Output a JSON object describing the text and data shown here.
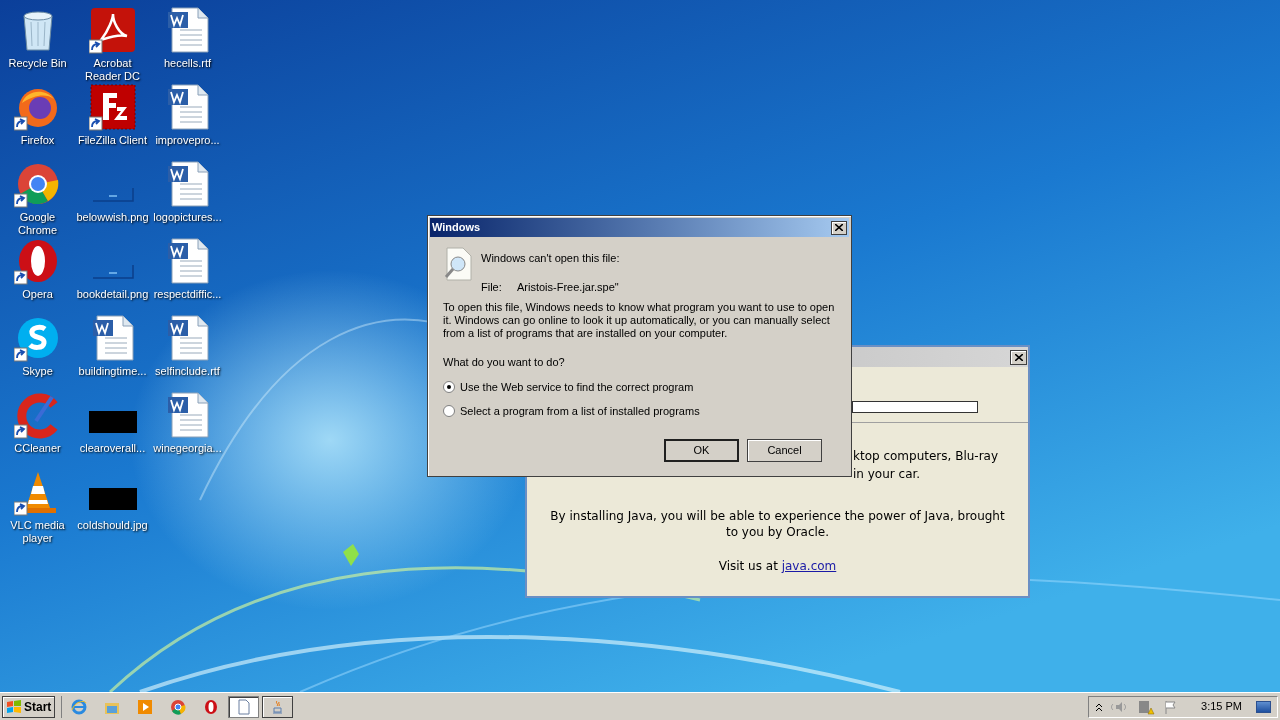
{
  "desktop_icons": [
    {
      "label": "Recycle Bin",
      "kind": "recycle",
      "shortcut": false
    },
    {
      "label": "Firefox",
      "kind": "firefox",
      "shortcut": true
    },
    {
      "label": "Google Chrome",
      "kind": "chrome",
      "shortcut": true
    },
    {
      "label": "Opera",
      "kind": "opera",
      "shortcut": true
    },
    {
      "label": "Skype",
      "kind": "skype",
      "shortcut": true
    },
    {
      "label": "CCleaner",
      "kind": "ccleaner",
      "shortcut": true
    },
    {
      "label": "VLC media player",
      "kind": "vlc",
      "shortcut": true
    },
    {
      "label": "Acrobat Reader DC",
      "kind": "pdf",
      "shortcut": true
    },
    {
      "label": "FileZilla Client",
      "kind": "filezilla",
      "shortcut": true
    },
    {
      "label": "belowwish.png",
      "kind": "blank-image",
      "shortcut": false
    },
    {
      "label": "bookdetail.png",
      "kind": "blank-image",
      "shortcut": false
    },
    {
      "label": "buildingtime...",
      "kind": "doc",
      "shortcut": false
    },
    {
      "label": "clearoverall...",
      "kind": "black-image",
      "shortcut": false
    },
    {
      "label": "coldshould.jpg",
      "kind": "black-image",
      "shortcut": false
    },
    {
      "label": "hecells.rtf",
      "kind": "doc",
      "shortcut": false
    },
    {
      "label": "improvepro...",
      "kind": "doc",
      "shortcut": false
    },
    {
      "label": "logopictures...",
      "kind": "doc",
      "shortcut": false
    },
    {
      "label": "respectdiffic...",
      "kind": "doc",
      "shortcut": false
    },
    {
      "label": "selfinclude.rtf",
      "kind": "doc",
      "shortcut": false
    },
    {
      "label": "winegeorgia...",
      "kind": "doc",
      "shortcut": false
    }
  ],
  "java_window": {
    "fragment_1": "ktop computers, Blu-ray",
    "fragment_2": "in your car.",
    "paragraph": "By installing Java, you will be able to experience the power of Java, brought to you by Oracle.",
    "visit_text": "Visit us at",
    "link": "java.com"
  },
  "dialog": {
    "title": "Windows",
    "heading": "Windows can't open this file:",
    "file_label": "File:",
    "file_name": "Aristois-Free.jar.spe\"",
    "body": "To open this file, Windows needs to know what program you want to use to open it. Windows can go online to look it up automatically, or you can manually select from a list of programs that are installed on your computer.",
    "question": "What do you want to do?",
    "options": [
      {
        "label": "Use the Web service to find the correct program",
        "selected": true
      },
      {
        "label": "Select a program from a list of installed programs",
        "selected": false
      }
    ],
    "buttons": [
      {
        "label": "OK",
        "default": true
      },
      {
        "label": "Cancel",
        "default": false
      }
    ]
  },
  "taskbar": {
    "start": "Start",
    "quick_launch": [
      {
        "kind": "ie"
      },
      {
        "kind": "folder"
      },
      {
        "kind": "media"
      },
      {
        "kind": "chrome"
      },
      {
        "kind": "opera"
      }
    ],
    "tasks": [
      {
        "kind": "document",
        "selected": true
      },
      {
        "kind": "java",
        "selected": false
      }
    ],
    "clock": "3:15 PM"
  }
}
